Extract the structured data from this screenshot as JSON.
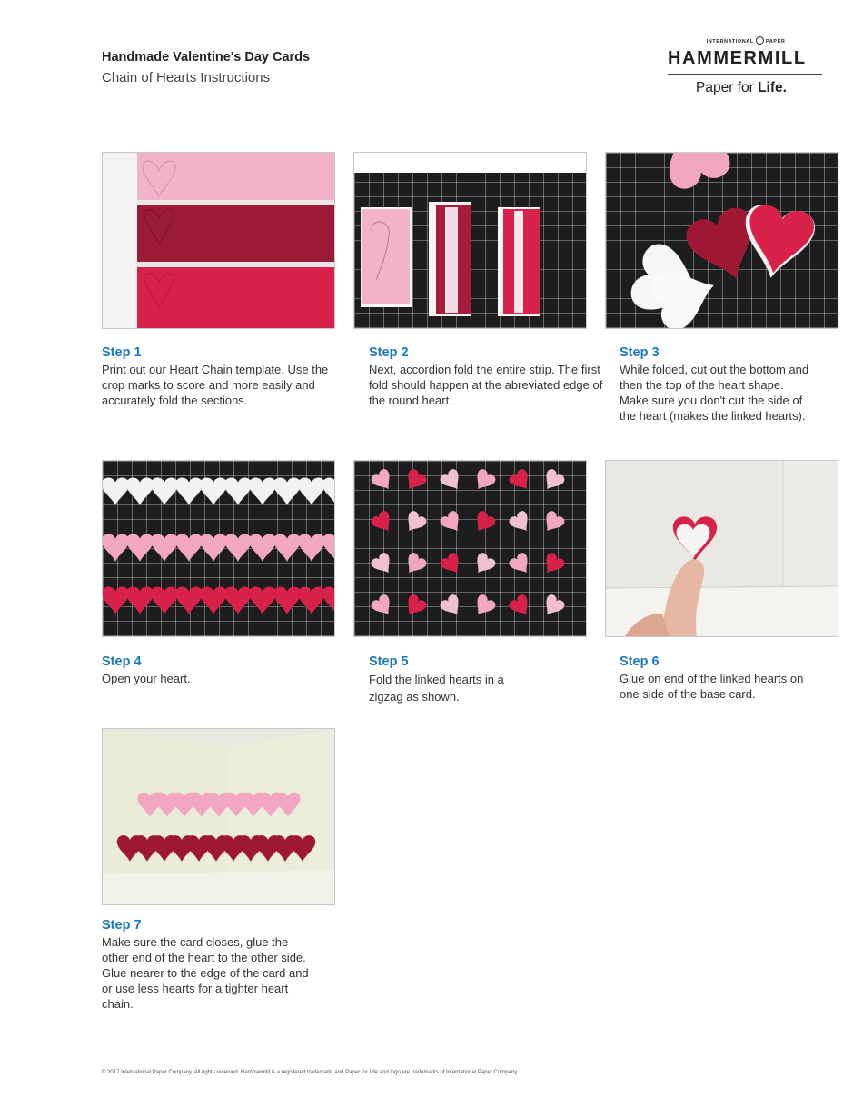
{
  "header": {
    "title": "Handmade Valentine's Day Cards",
    "subtitle": "Chain of Hearts Instructions"
  },
  "logo": {
    "company_left": "INTERNATIONAL",
    "company_right": "PAPER",
    "brand": "HAMMERMILL",
    "tagline_prefix": "Paper for",
    "tagline_bold": "Life."
  },
  "steps": [
    {
      "title": "Step 1",
      "text": "Print out our Heart Chain template. Use the crop marks to score and more easily and accurately fold the sections.",
      "photo_icon": "heart-template-strips-photo"
    },
    {
      "title": "Step 2",
      "text": "Next, accordion fold the entire strip. The first fold should happen at the abreviated edge of the round heart.",
      "photo_icon": "accordion-fold-photo"
    },
    {
      "title": "Step 3",
      "text": "While folded, cut out the bottom and then the top of the heart shape. Make sure you don't cut the side of the heart (makes the linked hearts).",
      "photo_icon": "cut-hearts-photo"
    },
    {
      "title": "Step 4",
      "text": "Open your heart.",
      "photo_icon": "heart-chains-photo"
    },
    {
      "title": "Step 5",
      "text": "Fold the linked hearts in a zigzag as shown.",
      "photo_icon": "zigzag-hearts-photo"
    },
    {
      "title": "Step 6",
      "text": "Glue on end of the linked hearts on one side of the base card.",
      "photo_icon": "glue-heart-photo"
    },
    {
      "title": "Step 7",
      "text": "Make sure the card closes, glue the other end of the heart to the other side. Glue nearer to the edge of the card and or use less hearts for a tighter heart chain.",
      "photo_icon": "finished-card-photo"
    }
  ],
  "footer": {
    "copyright": "© 2017 International Paper Company. All rights reserved. Hammermill is a registered trademark, and Paper for Life and logo are trademarks of International Paper Company."
  },
  "colors": {
    "step_title": "#1a78c2",
    "light_pink": "#f2a7c0",
    "dark_red": "#9e1834",
    "bright_red": "#d8224a",
    "grid_mat": "#1c1c1c"
  }
}
